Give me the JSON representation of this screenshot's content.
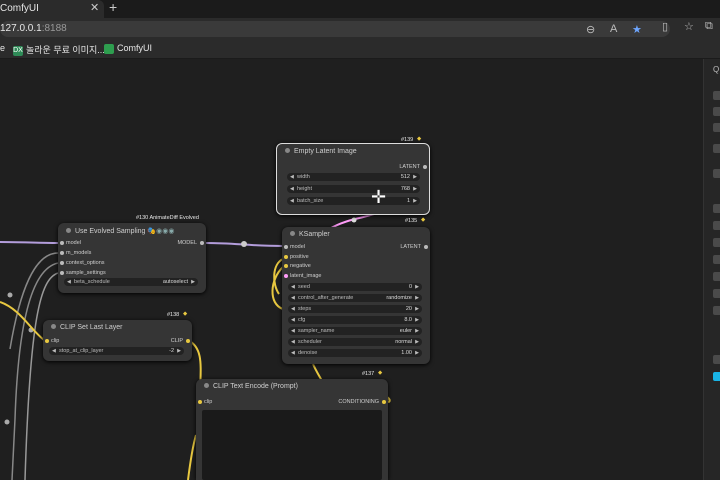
{
  "browser": {
    "tab_title": "ComfyUI",
    "tab_close": "✕",
    "new_tab": "+",
    "url_host": "127.0.0.1",
    "url_port": ":8188",
    "bookmarks": [
      {
        "label": "e"
      },
      {
        "label": "놀라운 무료 이미지..."
      },
      {
        "label": "ComfyUI"
      }
    ]
  },
  "nodes": {
    "empty_latent": {
      "id": "#139",
      "title": "Empty Latent Image",
      "output": "LATENT",
      "widgets": [
        {
          "name": "width",
          "value": "512"
        },
        {
          "name": "height",
          "value": "768"
        },
        {
          "name": "batch_size",
          "value": "1"
        }
      ]
    },
    "evolved_sampling": {
      "id": "#130 AnimateDiff Evolved",
      "title": "Use Evolved Sampling",
      "output": "MODEL",
      "inputs": [
        "model",
        "m_models",
        "context_options",
        "sample_settings"
      ],
      "widget": {
        "name": "beta_schedule",
        "value": "autoselect"
      }
    },
    "ksampler": {
      "id": "#135",
      "title": "KSampler",
      "output": "LATENT",
      "inputs": [
        "model",
        "positive",
        "negative",
        "latent_image"
      ],
      "widgets": [
        {
          "name": "seed",
          "value": "0"
        },
        {
          "name": "control_after_generate",
          "value": "randomize"
        },
        {
          "name": "steps",
          "value": "20"
        },
        {
          "name": "cfg",
          "value": "8.0"
        },
        {
          "name": "sampler_name",
          "value": "euler"
        },
        {
          "name": "scheduler",
          "value": "normal"
        },
        {
          "name": "denoise",
          "value": "1.00"
        }
      ]
    },
    "clip_last_layer": {
      "id": "#138",
      "title": "CLIP Set Last Layer",
      "input": "clip",
      "output": "CLIP",
      "widget": {
        "name": "stop_at_clip_layer",
        "value": "-2"
      }
    },
    "clip_text_encode": {
      "id": "#137",
      "title": "CLIP Text Encode (Prompt)",
      "input": "clip",
      "output": "CONDITIONING"
    }
  },
  "colors": {
    "canvas": "#1f1f1f",
    "node": "#353535",
    "clip_wire": "#e8c840",
    "latent_wire": "#ff9cf9",
    "model_wire": "#b39ddb",
    "accent": "#19b4e6"
  }
}
